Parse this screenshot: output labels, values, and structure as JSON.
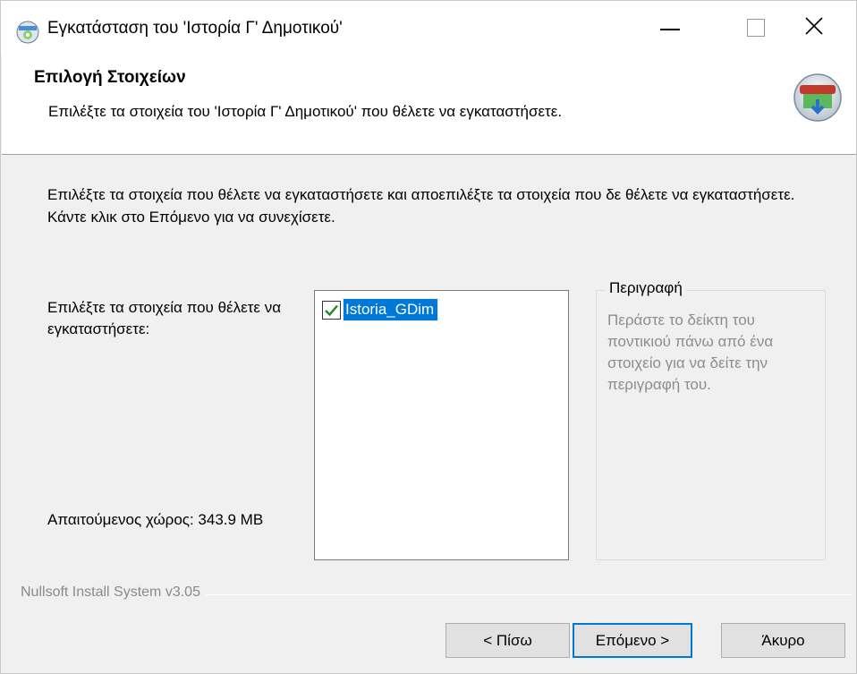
{
  "window": {
    "title": "Εγκατάσταση του 'Ιστορία Γ' Δημοτικού'",
    "icons": {
      "app": "installer-disc-icon",
      "minimize": "minimize-icon",
      "maximize": "maximize-icon",
      "close": "close-icon"
    }
  },
  "header": {
    "title": "Επιλογή Στοιχείων",
    "subtitle": "Επιλέξτε τα στοιχεία του 'Ιστορία Γ' Δημοτικού' που θέλετε να εγκαταστήσετε.",
    "icon": "nsis-installer-icon"
  },
  "body": {
    "intro": "Επιλέξτε τα στοιχεία που θέλετε να εγκαταστήσετε και αποεπιλέξτε τα στοιχεία που δε θέλετε να εγκαταστήσετε. Κάντε κλικ στο Επόμενο για να συνεχίσετε.",
    "select_label": "Επιλέξτε τα στοιχεία που θέλετε να εγκαταστήσετε:",
    "space_required": "Απαιτούμενος χώρος: 343.9 MB"
  },
  "components": [
    {
      "label": "Istoria_GDim",
      "checked": true,
      "selected": true
    }
  ],
  "description": {
    "legend": "Περιγραφή",
    "text": "Περάστε το δείκτη του ποντικιού πάνω από ένα στοιχείο για να δείτε την περιγραφή του."
  },
  "branding": "Nullsoft Install System v3.05",
  "buttons": {
    "back": "< Πίσω",
    "next": "Επόμενο >",
    "cancel": "Άκυρο"
  },
  "colors": {
    "accent": "#0078d7",
    "dialog_bg": "#f0f0f0",
    "disabled_text": "#8d8d8d",
    "checkmark": "#1f8a1f"
  }
}
